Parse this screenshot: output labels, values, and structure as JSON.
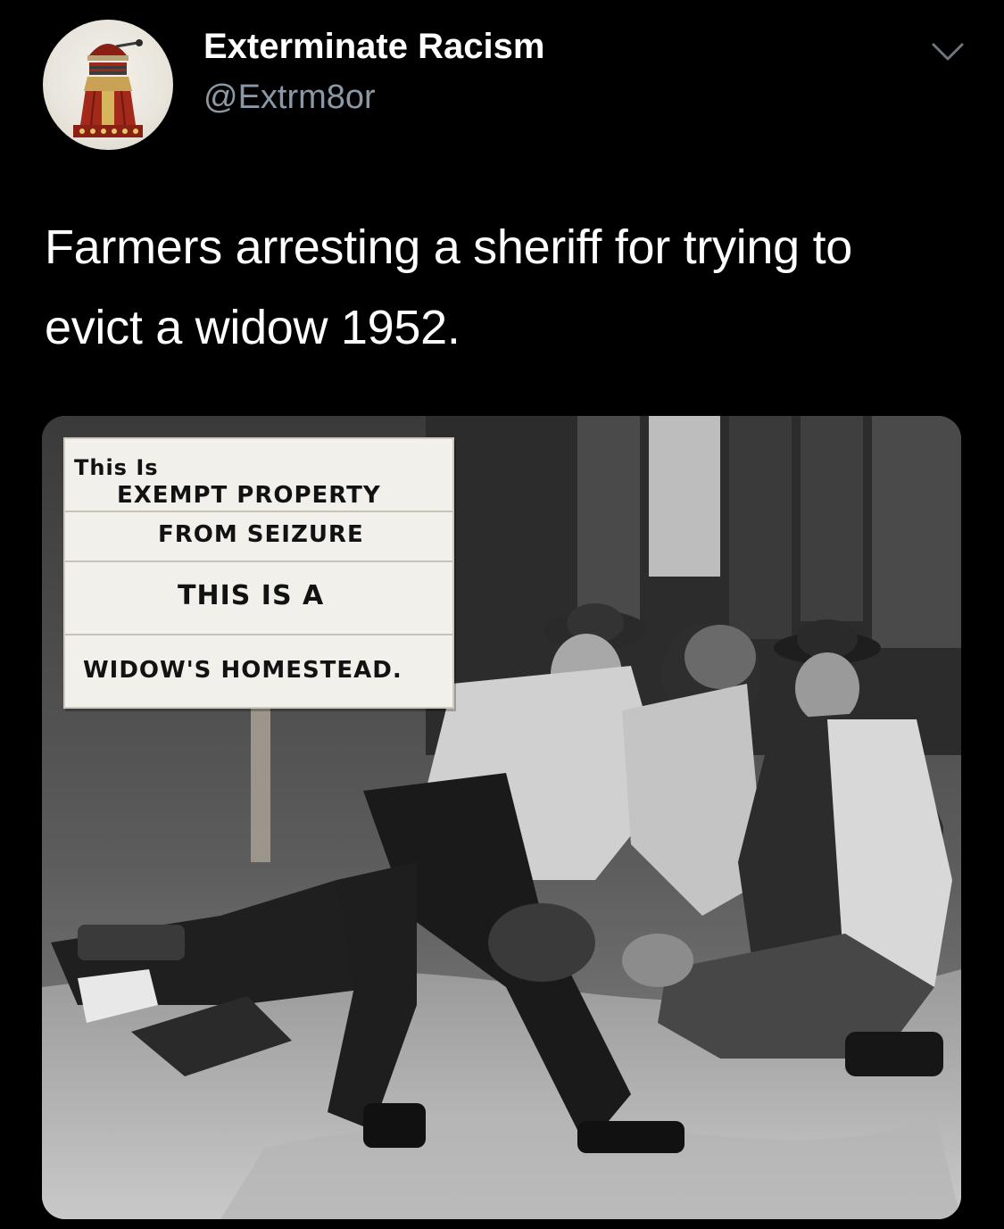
{
  "tweet": {
    "display_name": "Exterminate Racism",
    "handle": "@Extrm8or",
    "text": "Farmers arresting a sheriff for trying to evict a widow 1952."
  },
  "icons": {
    "avatar": "dalek-avatar",
    "more": "chevron-down-icon"
  },
  "photo_sign": {
    "line1": "This Is",
    "line2": "EXEMPT PROPERTY",
    "line3": "FROM SEIZURE",
    "line4": "THIS IS A",
    "line5": "WIDOW'S HOMESTEAD."
  },
  "colors": {
    "background": "#000000",
    "text_primary": "#ffffff",
    "text_secondary": "#8b98a5"
  }
}
